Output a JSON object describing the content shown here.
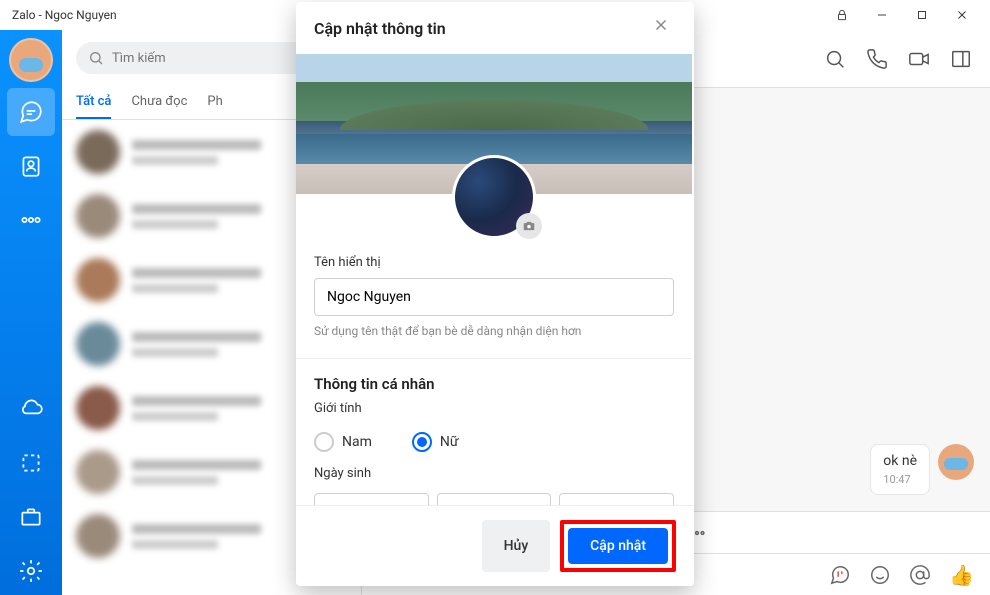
{
  "titlebar": {
    "title": "Zalo - Ngoc Nguyen"
  },
  "search": {
    "placeholder": "Tìm kiếm"
  },
  "tabs": {
    "all": "Tất cả",
    "unread": "Chưa đọc",
    "p": "Ph"
  },
  "chat": {
    "msg_text": "ok nè",
    "msg_time": "10:47"
  },
  "modal": {
    "title": "Cập nhật thông tin",
    "display_name_label": "Tên hiển thị",
    "display_name_value": "Ngoc Nguyen",
    "display_name_hint": "Sử dụng tên thật để bạn bè dễ dàng nhận diện hơn",
    "personal_info_title": "Thông tin cá nhân",
    "gender_label": "Giới tính",
    "gender_male": "Nam",
    "gender_female": "Nữ",
    "dob_label": "Ngày sinh",
    "btn_cancel": "Hủy",
    "btn_update": "Cập nhật"
  }
}
